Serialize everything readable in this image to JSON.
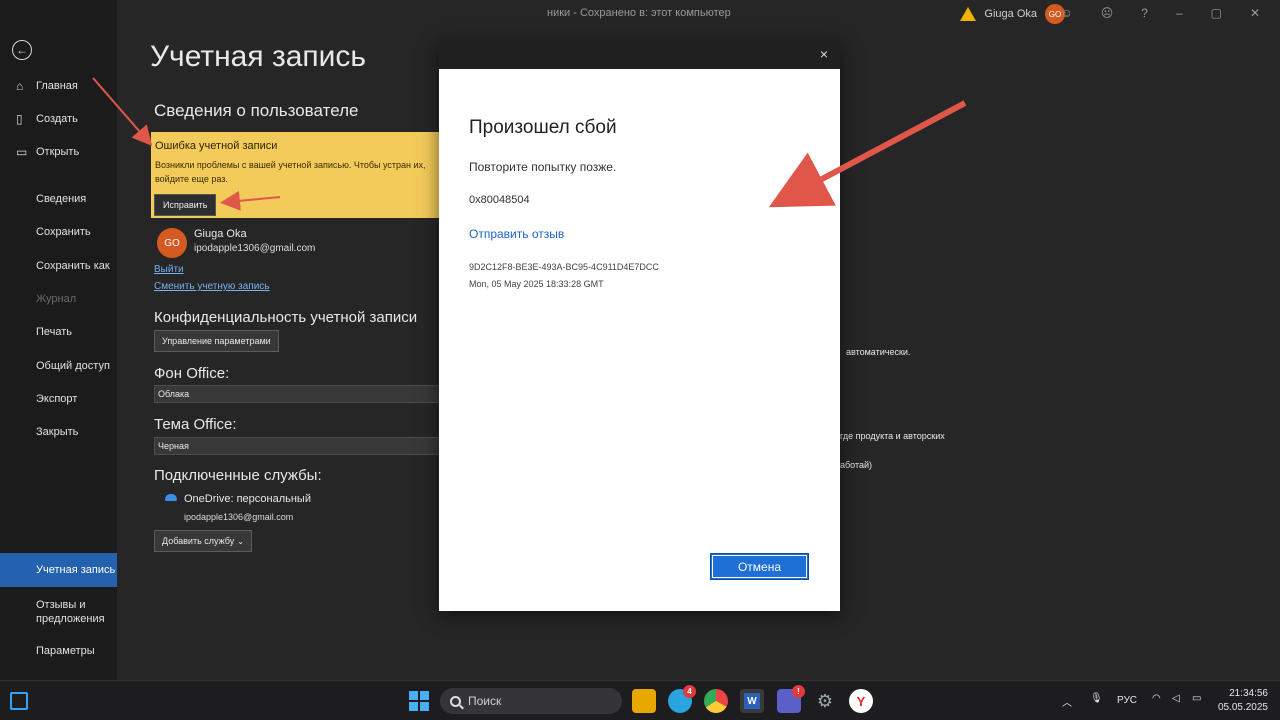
{
  "titlebar": {
    "doc_title": "ники - Сохранено в: этот компьютер",
    "user_name": "Giuga Oka",
    "user_initials": "GO"
  },
  "nav": {
    "items": [
      {
        "label": "Главная",
        "icon": "home-icon"
      },
      {
        "label": "Создать",
        "icon": "new-document-icon"
      },
      {
        "label": "Открыть",
        "icon": "folder-open-icon"
      },
      {
        "label": "Сведения"
      },
      {
        "label": "Сохранить"
      },
      {
        "label": "Сохранить как"
      },
      {
        "label": "Журнал",
        "disabled": true
      },
      {
        "label": "Печать"
      },
      {
        "label": "Общий доступ"
      },
      {
        "label": "Экспорт"
      },
      {
        "label": "Закрыть"
      },
      {
        "label": "Учетная запись",
        "active": true
      },
      {
        "label": "Отзывы и предложения"
      },
      {
        "label": "Параметры"
      }
    ]
  },
  "main": {
    "page_title": "Учетная запись",
    "user_info_heading": "Сведения о пользователе",
    "error": {
      "title": "Ошибка учетной записи",
      "description": "Возникли проблемы с вашей учетной записью. Чтобы устран их, войдите еще раз.",
      "fix_button": "Исправить"
    },
    "user": {
      "initials": "GO",
      "name": "Giuga Oka",
      "email": "ipodapple1306@gmail.com",
      "sign_out": "Выйти",
      "switch_account": "Сменить учетную запись"
    },
    "privacy_heading": "Конфиденциальность учетной записи",
    "privacy_button": "Управление параметрами",
    "background_heading": "Фон Office:",
    "background_value": "Облака",
    "theme_heading": "Тема Office:",
    "theme_value": "Черная",
    "services_heading": "Подключенные службы:",
    "service": {
      "name": "OneDrive: персональный",
      "email": "ipodapple1306@gmail.com"
    },
    "add_service_button": "Добавить службу",
    "right_fragments": [
      "автоматически.",
      "где продукта и авторских",
      "аботай)"
    ]
  },
  "dialog": {
    "title": "Произошел сбой",
    "message": "Повторите попытку позже.",
    "code": "0x80048504",
    "feedback_link": "Отправить отзыв",
    "guid": "9D2C12F8-BE3E-493A-BC95-4C911D4E7DCC",
    "timestamp": "Mon, 05 May 2025 18:33:28 GMT",
    "cancel_button": "Отмена",
    "close_glyph": "×"
  },
  "taskbar": {
    "search_label": "Поиск",
    "telegram_badge": "4",
    "teams_badge": "!",
    "word_letter": "W",
    "lang": "РУС",
    "time": "21:34:56",
    "date": "05.05.2025"
  },
  "colors": {
    "accent": "#2462b0",
    "error_bg": "#f2cb5b",
    "avatar": "#d55a22",
    "dialog_button": "#1e6fd6",
    "annotation_arrow": "#e0574a"
  }
}
